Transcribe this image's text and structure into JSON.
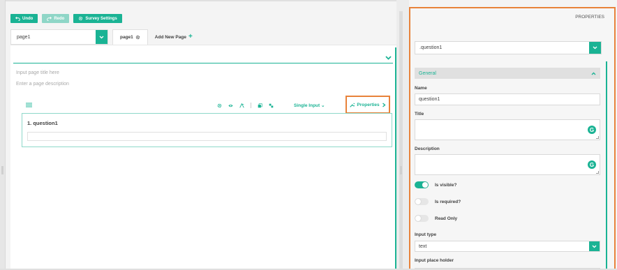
{
  "toolbar": {
    "undo_label": "Undo",
    "redo_label": "Redo",
    "settings_label": "Survey Settings"
  },
  "pages": {
    "selected": "page1",
    "tab_label": "page1",
    "add_label": "Add New Page"
  },
  "page": {
    "title_placeholder": "Input page title here",
    "description_placeholder": "Enter a page description"
  },
  "question": {
    "title": "1. question1",
    "type_label": "Single Input",
    "properties_label": "Properties"
  },
  "panel": {
    "heading": "PROPERTIES",
    "selected_object": "question1",
    "section_label": "General",
    "name_label": "Name",
    "name_value": "question1",
    "title_label": "Title",
    "description_label": "Description",
    "visible_label": "Is visible?",
    "required_label": "Is required?",
    "readonly_label": "Read Only",
    "input_type_label": "Input type",
    "input_type_value": "text",
    "placeholder_label": "Input place holder",
    "visible_on": true,
    "required_on": false,
    "readonly_on": false
  },
  "colors": {
    "accent": "#1ab394",
    "highlight": "#e8823a"
  }
}
